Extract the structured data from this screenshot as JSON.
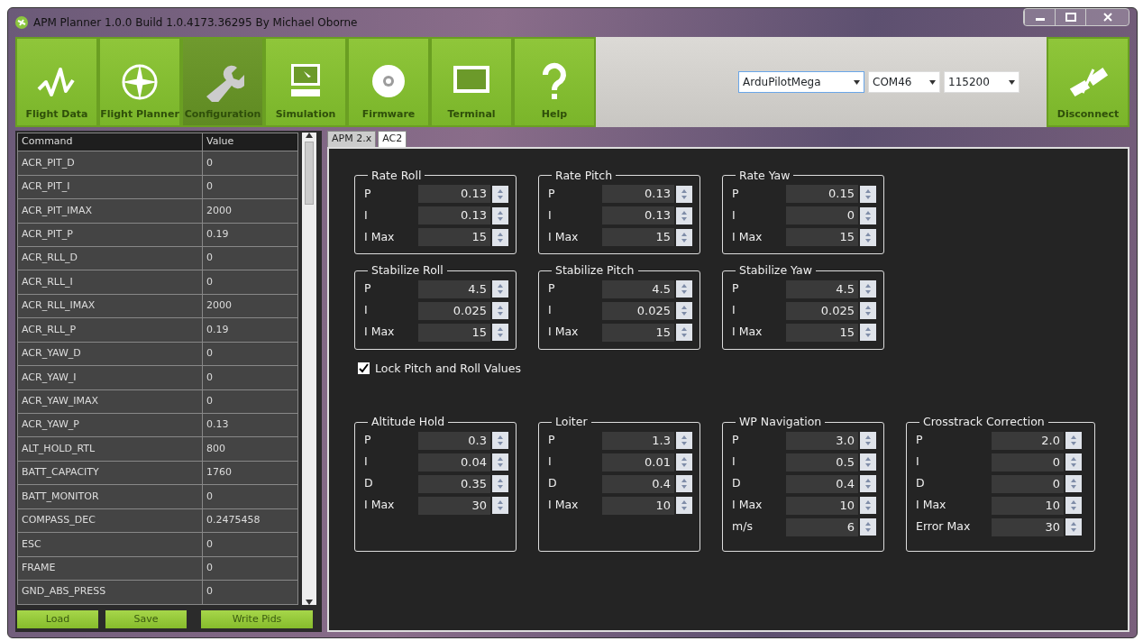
{
  "window": {
    "title": "APM Planner 1.0.0 Build 1.0.4173.36295 By Michael Oborne"
  },
  "toolbar": [
    {
      "label": "Flight Data",
      "selected": false
    },
    {
      "label": "Flight Planner",
      "selected": false
    },
    {
      "label": "Configuration",
      "selected": true
    },
    {
      "label": "Simulation",
      "selected": false
    },
    {
      "label": "Firmware",
      "selected": false
    },
    {
      "label": "Terminal",
      "selected": false
    },
    {
      "label": "Help",
      "selected": false
    }
  ],
  "connection": {
    "board": "ArduPilotMega",
    "port": "COM46",
    "baud": "115200",
    "button": "Disconnect"
  },
  "params": {
    "columns": [
      "Command",
      "Value"
    ],
    "rows": [
      [
        "ACR_PIT_D",
        "0"
      ],
      [
        "ACR_PIT_I",
        "0"
      ],
      [
        "ACR_PIT_IMAX",
        "2000"
      ],
      [
        "ACR_PIT_P",
        "0.19"
      ],
      [
        "ACR_RLL_D",
        "0"
      ],
      [
        "ACR_RLL_I",
        "0"
      ],
      [
        "ACR_RLL_IMAX",
        "2000"
      ],
      [
        "ACR_RLL_P",
        "0.19"
      ],
      [
        "ACR_YAW_D",
        "0"
      ],
      [
        "ACR_YAW_I",
        "0"
      ],
      [
        "ACR_YAW_IMAX",
        "0"
      ],
      [
        "ACR_YAW_P",
        "0.13"
      ],
      [
        "ALT_HOLD_RTL",
        "800"
      ],
      [
        "BATT_CAPACITY",
        "1760"
      ],
      [
        "BATT_MONITOR",
        "0"
      ],
      [
        "COMPASS_DEC",
        "0.2475458"
      ],
      [
        "ESC",
        "0"
      ],
      [
        "FRAME",
        "0"
      ],
      [
        "GND_ABS_PRESS",
        "0"
      ]
    ],
    "buttons": [
      "Load",
      "Save",
      "Write Pids"
    ]
  },
  "tabs": [
    {
      "label": "APM 2.x",
      "selected": false
    },
    {
      "label": "AC2",
      "selected": true
    }
  ],
  "group_rows": [
    [
      {
        "title": "Rate Roll",
        "fields": [
          {
            "label": "P",
            "value": "0.13"
          },
          {
            "label": "I",
            "value": "0.13"
          },
          {
            "label": "I Max",
            "value": "15"
          }
        ]
      },
      {
        "title": "Rate Pitch",
        "fields": [
          {
            "label": "P",
            "value": "0.13"
          },
          {
            "label": "I",
            "value": "0.13"
          },
          {
            "label": "I Max",
            "value": "15"
          }
        ]
      },
      {
        "title": "Rate Yaw",
        "fields": [
          {
            "label": "P",
            "value": "0.15"
          },
          {
            "label": "I",
            "value": "0"
          },
          {
            "label": "I Max",
            "value": "15"
          }
        ]
      }
    ],
    [
      {
        "title": "Stabilize  Roll",
        "fields": [
          {
            "label": "P",
            "value": "4.5"
          },
          {
            "label": "I",
            "value": "0.025"
          },
          {
            "label": "I Max",
            "value": "15"
          }
        ]
      },
      {
        "title": "Stabilize  Pitch",
        "fields": [
          {
            "label": "P",
            "value": "4.5"
          },
          {
            "label": "I",
            "value": "0.025"
          },
          {
            "label": "I Max",
            "value": "15"
          }
        ]
      },
      {
        "title": "Stabilize  Yaw",
        "fields": [
          {
            "label": "P",
            "value": "4.5"
          },
          {
            "label": "I",
            "value": "0.025"
          },
          {
            "label": "I Max",
            "value": "15"
          }
        ]
      }
    ]
  ],
  "lock": {
    "label": "Lock Pitch and Roll Values",
    "checked": true
  },
  "lower_groups": [
    {
      "title": "Altitude Hold",
      "fields": [
        {
          "label": "P",
          "value": "0.3"
        },
        {
          "label": "I",
          "value": "0.04"
        },
        {
          "label": "D",
          "value": "0.35"
        },
        {
          "label": "I Max",
          "value": "30"
        }
      ]
    },
    {
      "title": "Loiter",
      "fields": [
        {
          "label": "P",
          "value": "1.3"
        },
        {
          "label": "I",
          "value": "0.01"
        },
        {
          "label": "D",
          "value": "0.4"
        },
        {
          "label": "I Max",
          "value": "10"
        }
      ]
    },
    {
      "title": "WP Navigation",
      "fields": [
        {
          "label": "P",
          "value": "3.0"
        },
        {
          "label": "I",
          "value": "0.5"
        },
        {
          "label": "D",
          "value": "0.4"
        },
        {
          "label": "I Max",
          "value": "10"
        },
        {
          "label": "m/s",
          "value": "6"
        }
      ]
    },
    {
      "title": "Crosstrack Correction",
      "fields": [
        {
          "label": "P",
          "value": "2.0"
        },
        {
          "label": "I",
          "value": "0"
        },
        {
          "label": "D",
          "value": "0"
        },
        {
          "label": "I Max",
          "value": "10"
        },
        {
          "label": "Error Max",
          "value": "30"
        }
      ]
    }
  ]
}
